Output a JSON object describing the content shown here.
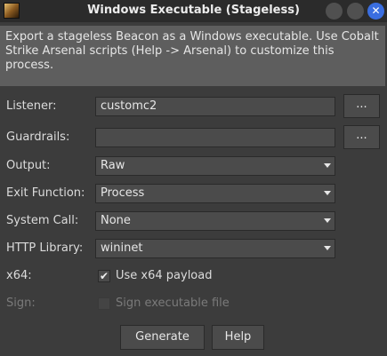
{
  "window": {
    "title": "Windows Executable (Stageless)",
    "close_glyph": "✕"
  },
  "description": "Export a stageless Beacon as a Windows executable. Use Cobalt Strike Arsenal scripts (Help -> Arsenal) to customize this process.",
  "form": {
    "listener": {
      "label": "Listener:",
      "value": "customc2",
      "browse_label": "..."
    },
    "guardrails": {
      "label": "Guardrails:",
      "value": "",
      "browse_label": "..."
    },
    "output": {
      "label": "Output:",
      "value": "Raw"
    },
    "exit_function": {
      "label": "Exit Function:",
      "value": "Process"
    },
    "system_call": {
      "label": "System Call:",
      "value": "None"
    },
    "http_library": {
      "label": "HTTP Library:",
      "value": "wininet"
    },
    "x64": {
      "label": "x64:",
      "checkbox_label": "Use x64 payload",
      "checked": true,
      "check_glyph": "✔"
    },
    "sign": {
      "label": "Sign:",
      "checkbox_label": "Sign executable file",
      "checked": false,
      "enabled": false
    }
  },
  "buttons": {
    "generate": "Generate",
    "help": "Help"
  },
  "colors": {
    "background": "#3c3c3c",
    "titlebar": "#2b2b2b",
    "description_bg": "#5e5e5e",
    "field_bg": "#4b4b4b",
    "close_button": "#3a6ee0"
  }
}
